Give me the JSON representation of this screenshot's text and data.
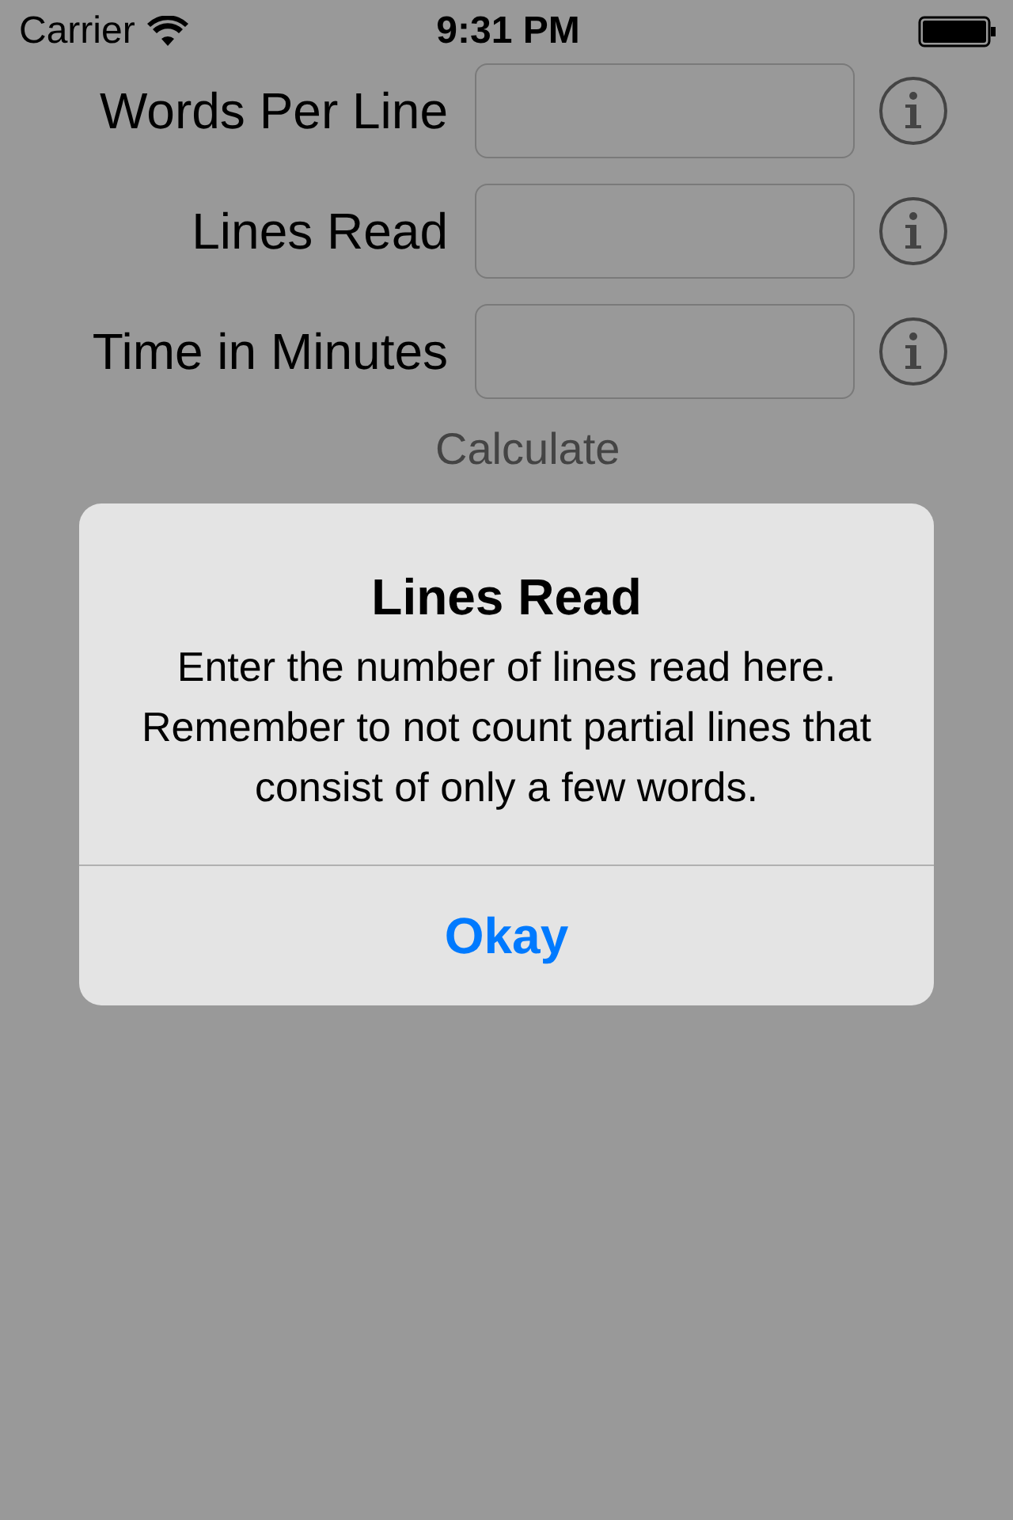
{
  "status_bar": {
    "carrier": "Carrier",
    "time": "9:31 PM"
  },
  "form": {
    "rows": [
      {
        "label": "Words Per Line",
        "value": ""
      },
      {
        "label": "Lines Read",
        "value": ""
      },
      {
        "label": "Time in Minutes",
        "value": ""
      }
    ],
    "calculate_button": "Calculate"
  },
  "alert": {
    "title": "Lines Read",
    "message": "Enter the number of lines read here. Remember to not count partial lines that consist of only a few words.",
    "buttons": [
      "Okay"
    ]
  }
}
